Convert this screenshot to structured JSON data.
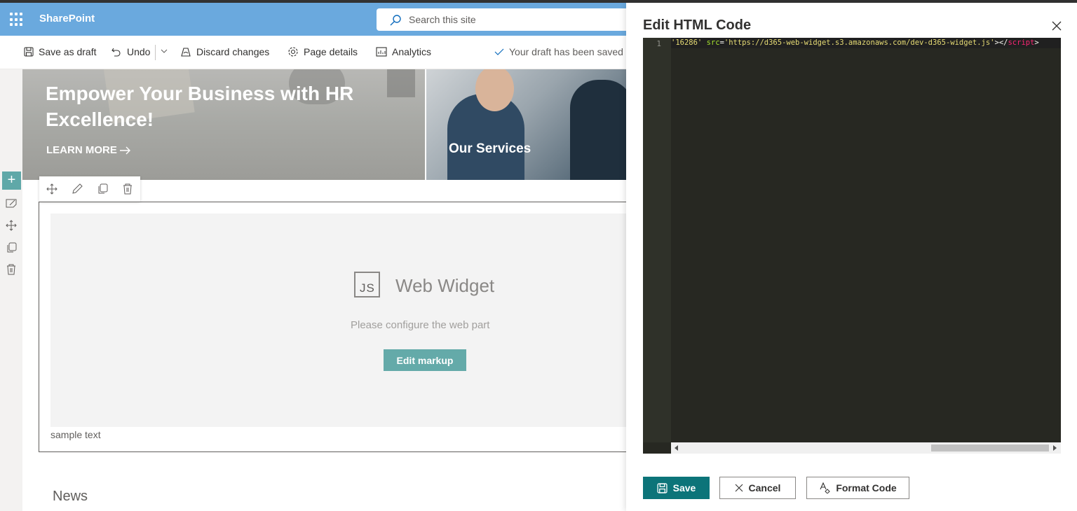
{
  "app": {
    "name": "SharePoint",
    "search_placeholder": "Search this site"
  },
  "commandbar": {
    "save_draft": "Save as draft",
    "undo": "Undo",
    "discard": "Discard changes",
    "page_details": "Page details",
    "analytics": "Analytics",
    "saved_status": "Your draft has been saved"
  },
  "hero": {
    "headline": "Empower Your Business with HR Excellence!",
    "link": "LEARN MORE",
    "tile2_caption": "Our Services"
  },
  "widget": {
    "js_label": "JS",
    "title": "Web Widget",
    "subtitle": "Please configure the web part",
    "button": "Edit markup",
    "sample_text": "sample text"
  },
  "news_heading": "News",
  "panel": {
    "title": "Edit HTML Code",
    "line_number": "1",
    "code": {
      "id_value": "'16286'",
      "src_attr": "src",
      "equals": "=",
      "src_value": "'https://d365-web-widget.s3.amazonaws.com/dev-d365-widget.js'",
      "open_close": "></",
      "tag": "script",
      "end": ">"
    },
    "save": "Save",
    "cancel": "Cancel",
    "format": "Format Code"
  },
  "colors": {
    "suitebar": "#6aa9de",
    "accent_teal": "#0c7479",
    "widget_button": "#64aaa9",
    "editor_bg": "#272822"
  }
}
